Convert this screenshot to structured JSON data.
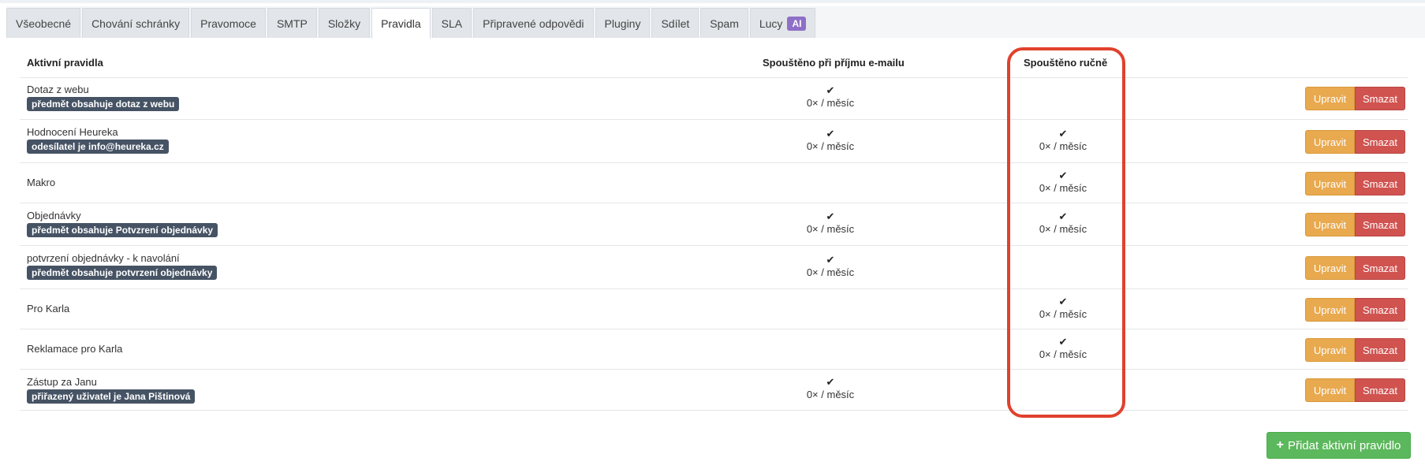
{
  "tabs": [
    {
      "label": "Všeobecné",
      "active": false
    },
    {
      "label": "Chování schránky",
      "active": false
    },
    {
      "label": "Pravomoce",
      "active": false
    },
    {
      "label": "SMTP",
      "active": false
    },
    {
      "label": "Složky",
      "active": false
    },
    {
      "label": "Pravidla",
      "active": true
    },
    {
      "label": "SLA",
      "active": false
    },
    {
      "label": "Připravené odpovědi",
      "active": false
    },
    {
      "label": "Pluginy",
      "active": false
    },
    {
      "label": "Sdílet",
      "active": false
    },
    {
      "label": "Spam",
      "active": false
    },
    {
      "label": "Lucy",
      "active": false,
      "badge": "AI"
    }
  ],
  "table": {
    "headers": {
      "name": "Aktivní pravidla",
      "on_email": "Spouštěno při příjmu e-mailu",
      "manual": "Spouštěno ručně"
    },
    "check_icon": "check-icon",
    "rows": [
      {
        "name": "Dotaz z webu",
        "condition": "předmět obsahuje dotaz z webu",
        "on_email": "0× / měsíc",
        "manual": null
      },
      {
        "name": "Hodnocení Heureka",
        "condition": "odesílatel je info@heureka.cz",
        "on_email": "0× / měsíc",
        "manual": "0× / měsíc"
      },
      {
        "name": "Makro",
        "condition": null,
        "on_email": null,
        "manual": "0× / měsíc"
      },
      {
        "name": "Objednávky",
        "condition": "předmět obsahuje Potvzrení objednávky",
        "on_email": "0× / měsíc",
        "manual": "0× / měsíc"
      },
      {
        "name": "potvrzení objednávky - k navolání",
        "condition": "předmět obsahuje potvrzení objednávky",
        "on_email": "0× / měsíc",
        "manual": null
      },
      {
        "name": "Pro Karla",
        "condition": null,
        "on_email": null,
        "manual": "0× / měsíc"
      },
      {
        "name": "Reklamace pro Karla",
        "condition": null,
        "on_email": null,
        "manual": "0× / měsíc"
      },
      {
        "name": "Zástup za Janu",
        "condition": "přiřazený uživatel je Jana Pištinová",
        "on_email": "0× / měsíc",
        "manual": null
      }
    ],
    "edit_label": "Upravit",
    "delete_label": "Smazat"
  },
  "add_button": {
    "label": "Přidat aktivní pravidlo",
    "icon": "plus-icon"
  },
  "colors": {
    "highlight": "#e0412d",
    "edit": "#e8a94f",
    "delete": "#d05350",
    "add": "#5cb85c",
    "condition_badge": "#465364",
    "ai_badge": "#8e6fc7"
  }
}
